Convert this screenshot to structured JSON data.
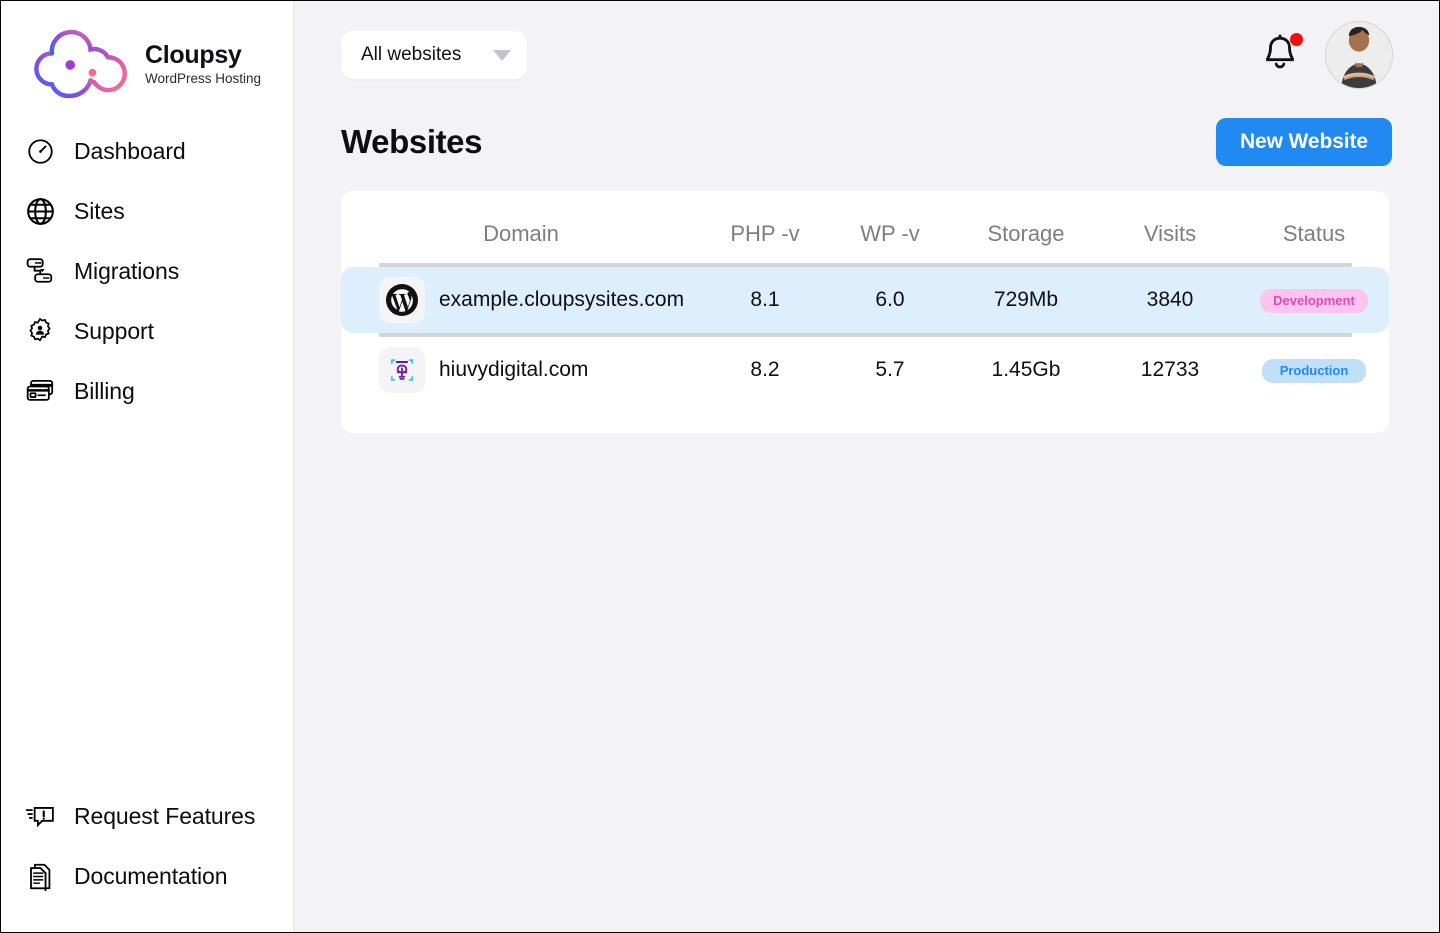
{
  "brand": {
    "name": "Cloupsy",
    "tagline": "WordPress Hosting",
    "logo_icon": "cloud-logo-icon",
    "logo_gradient_start": "#3a7bf7",
    "logo_gradient_end": "#f96b8b"
  },
  "sidebar": {
    "items": [
      {
        "label": "Dashboard",
        "icon": "gauge-icon"
      },
      {
        "label": "Sites",
        "icon": "globe-icon"
      },
      {
        "label": "Migrations",
        "icon": "server-migration-icon"
      },
      {
        "label": "Support",
        "icon": "gear-person-icon"
      },
      {
        "label": "Billing",
        "icon": "credit-card-icon"
      }
    ],
    "bottom_items": [
      {
        "label": "Request Features",
        "icon": "feedback-bubble-icon"
      },
      {
        "label": "Documentation",
        "icon": "documents-icon"
      }
    ]
  },
  "topbar": {
    "site_filter": {
      "selected": "All websites",
      "icon": "chevron-down-icon"
    },
    "notifications": {
      "icon": "bell-icon",
      "has_unread": true,
      "dot_color": "#f50d0d"
    },
    "avatar": {
      "icon": "user-avatar"
    }
  },
  "page": {
    "title": "Websites",
    "new_website_label": "New Website",
    "accent_color": "#2089f2"
  },
  "table": {
    "columns": [
      "Domain",
      "PHP -v",
      "WP -v",
      "Storage",
      "Visits",
      "Status"
    ],
    "rows": [
      {
        "icon": "wordpress-icon",
        "domain": "example.cloupsysites.com",
        "php": "8.1",
        "wp": "6.0",
        "storage": "729Mb",
        "visits": "3840",
        "status": "Development",
        "status_type": "dev",
        "highlighted": true
      },
      {
        "icon": "lightbulb-brackets-icon",
        "domain": "hiuvydigital.com",
        "php": "8.2",
        "wp": "5.7",
        "storage": "1.45Gb",
        "visits": "12733",
        "status": "Production",
        "status_type": "prod",
        "highlighted": false
      }
    ],
    "badge_colors": {
      "dev_bg": "#fbc5ee",
      "dev_text": "#e04bb0",
      "prod_bg": "#bfdffb",
      "prod_text": "#2089f2"
    }
  }
}
